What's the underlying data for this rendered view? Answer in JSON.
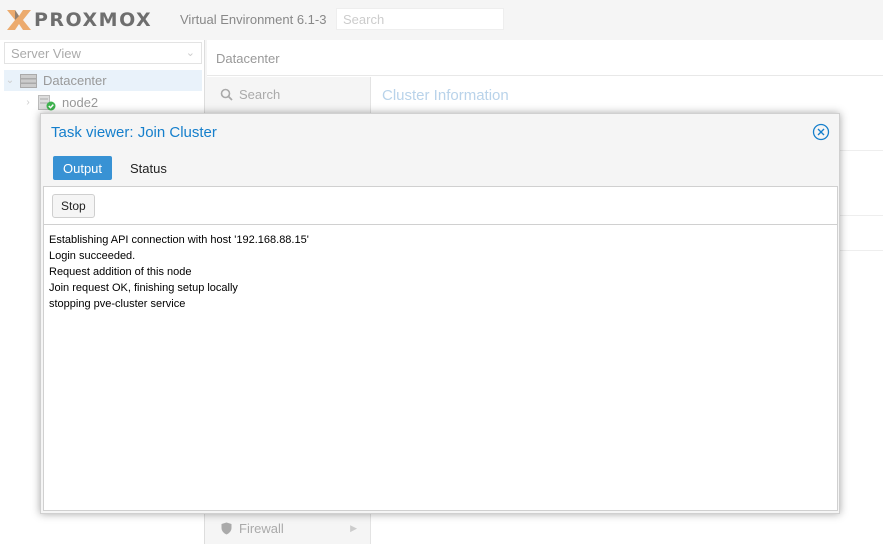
{
  "header": {
    "logo_text": "PROXMOX",
    "version": "Virtual Environment 6.1-3",
    "search_placeholder": "Search"
  },
  "tree": {
    "view_selector": "Server View",
    "items": [
      {
        "label": "Datacenter",
        "icon": "server-icon"
      },
      {
        "label": "node2",
        "icon": "node-online-icon"
      }
    ]
  },
  "main": {
    "breadcrumb": "Datacenter",
    "menu": [
      {
        "label": "Search",
        "icon": "search-icon"
      },
      {
        "label": "Firewall",
        "icon": "shield-icon"
      }
    ],
    "panel_title": "Cluster Information"
  },
  "modal": {
    "title": "Task viewer: Join Cluster",
    "tabs": [
      {
        "label": "Output",
        "active": true
      },
      {
        "label": "Status",
        "active": false
      }
    ],
    "stop_label": "Stop",
    "log": [
      "Establishing API connection with host '192.168.88.15'",
      "Login succeeded.",
      "Request addition of this node",
      "Join request OK, finishing setup locally",
      "stopping pve-cluster service"
    ]
  },
  "colors": {
    "accent": "#157fcc",
    "active_tab": "#3892d4",
    "logo_x": "#e57000"
  }
}
